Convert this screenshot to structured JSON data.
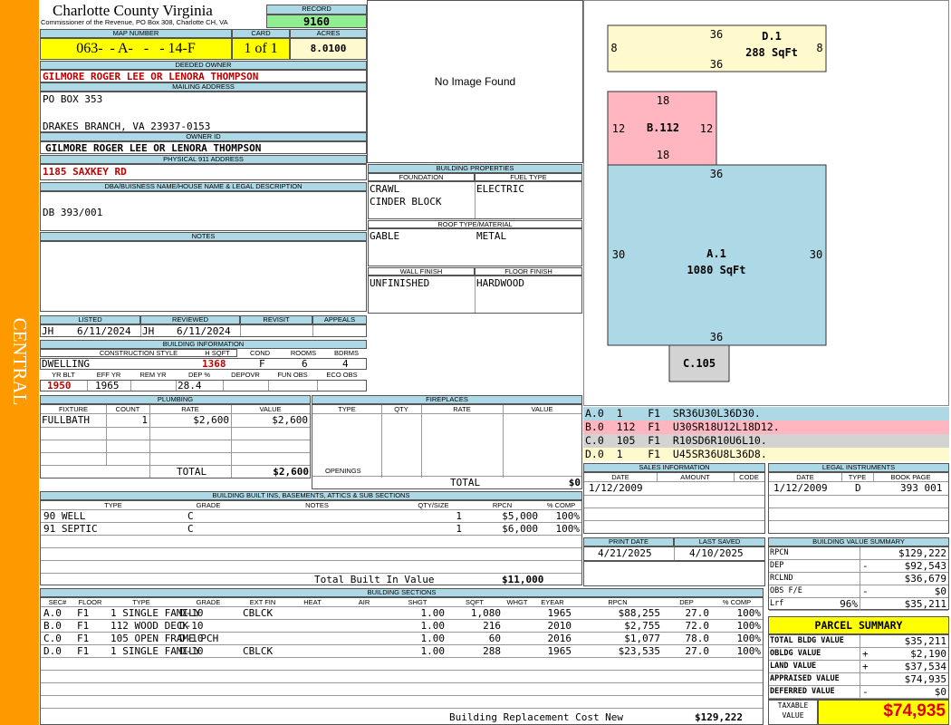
{
  "side_label": "CENTRAL",
  "header": {
    "county": "Charlotte County Virginia",
    "commissioner": "Commissioner of the Revenue, PO Box 308, Charlotte CH, VA",
    "record_label": "RECORD",
    "record": "9160",
    "map_number_label": "MAP NUMBER",
    "map_number": "063-  - A-   -   - 14-F",
    "card_label": "CARD",
    "card": "1 of 1",
    "acres_label": "ACRES",
    "acres": "8.0100"
  },
  "owner": {
    "deeded_label": "DEEDED OWNER",
    "deeded": "GILMORE ROGER LEE OR LENORA THOMPSON",
    "mailing_label": "MAILING ADDRESS",
    "mailing_line1": "PO BOX 353",
    "mailing_line2": "DRAKES BRANCH, VA 23937-0153",
    "owner_id_label": "OWNER ID",
    "owner_id": "GILMORE ROGER LEE OR LENORA THOMPSON",
    "physical_label": "PHYSICAL 911 ADDRESS",
    "physical": "1185 SAXKEY RD",
    "legal_label": "DBA/BUISNESS NAME/HOUSE NAME & LEGAL DESCRIPTION",
    "legal": "DB 393/001",
    "notes_label": "NOTES"
  },
  "photo": {
    "text": "No Image Found"
  },
  "building_properties": {
    "title": "BUILDING PROPERTIES",
    "foundation_label": "FOUNDATION",
    "fuel_label": "FUEL TYPE",
    "foundation1": "CRAWL",
    "foundation2": "CINDER BLOCK",
    "fuel": "ELECTRIC",
    "roof_label": "ROOF TYPE/MATERIAL",
    "roof_type": "GABLE",
    "roof_material": "METAL",
    "wall_label": "WALL FINISH",
    "floor_label": "FLOOR FINISH",
    "wall": "UNFINISHED",
    "floor": "HARDWOOD"
  },
  "listing": {
    "listed_label": "LISTED",
    "reviewed_label": "REVIEWED",
    "revisit_label": "REVISIT",
    "appeals_label": "APPEALS",
    "listed_by": "JH",
    "listed_date": "6/11/2024",
    "reviewed_by": "JH",
    "reviewed_date": "6/11/2024"
  },
  "building_info": {
    "title": "BUILDING INFORMATION",
    "style_label": "CONSTRUCTION STYLE",
    "hsqft_label": "H SQFT",
    "cond_label": "COND",
    "rooms_label": "ROOMS",
    "bdrms_label": "BDRMS",
    "style": "DWELLING",
    "hsqft": "1368",
    "cond": "F",
    "rooms": "6",
    "bdrms": "4",
    "yrblt_label": "YR BLT",
    "effyr_label": "EFF YR",
    "remyr_label": "REM YR",
    "dep_label": "DEP %",
    "depovr_label": "DEPOVR",
    "funobs_label": "FUN OBS",
    "ecoobs_label": "ECO OBS",
    "yrblt": "1950",
    "effyr": "1965",
    "dep": "28.4"
  },
  "plumbing": {
    "title": "PLUMBING",
    "cols": [
      "FIXTURE",
      "COUNT",
      "RATE",
      "VALUE"
    ],
    "rows": [
      {
        "fixture": "FULLBATH",
        "count": "1",
        "rate": "$2,600",
        "value": "$2,600"
      }
    ],
    "total_label": "TOTAL",
    "total": "$2,600"
  },
  "fireplaces": {
    "title": "FIREPLACES",
    "cols": [
      "TYPE",
      "QTY",
      "RATE",
      "VALUE"
    ],
    "openings_label": "OPENINGS",
    "total_label": "TOTAL",
    "total": "$0"
  },
  "builtins": {
    "title": "BUILDING BUILT INS, BASEMENTS, ATTICS & SUB SECTIONS",
    "cols": [
      "TYPE",
      "GRADE",
      "NOTES",
      "QTY/SIZE",
      "RPCN",
      "% COMP"
    ],
    "rows": [
      {
        "type": "90 WELL",
        "grade": "C",
        "notes": "",
        "qty": "1",
        "rpcn": "$5,000",
        "comp": "100%"
      },
      {
        "type": "91 SEPTIC",
        "grade": "C",
        "notes": "",
        "qty": "1",
        "rpcn": "$6,000",
        "comp": "100%"
      }
    ],
    "total_label": "Total Built In Value",
    "total": "$11,000"
  },
  "sections": {
    "title": "BUILDING SECTIONS",
    "cols": [
      "SEC#",
      "FLOOR",
      "TYPE",
      "GRADE",
      "EXT FIN",
      "HEAT",
      "AIR",
      "SHGT",
      "SQFT",
      "WHGT",
      "EYEAR",
      "RPCN",
      "DEP",
      "% COMP"
    ],
    "rows": [
      {
        "sec": "A.0",
        "floor": "F1",
        "type": "1 SINGLE FAMILY",
        "grade": "D-10",
        "ext": "CBLCK",
        "heat": "",
        "air": "",
        "shgt": "1.00",
        "sqft": "1,080",
        "whgt": "",
        "eyear": "1965",
        "rpcn": "$88,255",
        "dep": "27.0",
        "comp": "100%"
      },
      {
        "sec": "B.0",
        "floor": "F1",
        "type": "112 WOOD DECK",
        "grade": "D-10",
        "ext": "",
        "heat": "",
        "air": "",
        "shgt": "1.00",
        "sqft": "216",
        "whgt": "",
        "eyear": "2010",
        "rpcn": "$2,755",
        "dep": "72.0",
        "comp": "100%"
      },
      {
        "sec": "C.0",
        "floor": "F1",
        "type": "105 OPEN FRAME PCH",
        "grade": "D-10",
        "ext": "",
        "heat": "",
        "air": "",
        "shgt": "1.00",
        "sqft": "60",
        "whgt": "",
        "eyear": "2016",
        "rpcn": "$1,077",
        "dep": "78.0",
        "comp": "100%"
      },
      {
        "sec": "D.0",
        "floor": "F1",
        "type": "1 SINGLE FAMILY",
        "grade": "D-10",
        "ext": "CBLCK",
        "heat": "",
        "air": "",
        "shgt": "1.00",
        "sqft": "288",
        "whgt": "",
        "eyear": "1965",
        "rpcn": "$23,535",
        "dep": "27.0",
        "comp": "100%"
      }
    ],
    "total_label": "Building Replacement Cost New",
    "total": "$129,222"
  },
  "sketch": {
    "d": {
      "label": "D.1",
      "area": "288 SqFt",
      "top": "36",
      "bottom": "36",
      "left": "8",
      "right": "8"
    },
    "b": {
      "label": "B.112",
      "top": "18",
      "bottom": "18",
      "left": "12",
      "right": "12"
    },
    "a": {
      "label": "A.1",
      "area": "1080 SqFt",
      "top": "36",
      "bottom": "36",
      "left": "30",
      "right": "30"
    },
    "c": {
      "label": "C.105"
    },
    "colors": {
      "d": "#fffacd",
      "b": "#ffb6c1",
      "a": "#add8e6",
      "c": "#d3d3d3"
    }
  },
  "legend": [
    {
      "text": "A.0  1    F1  SR36U30L36D30.",
      "color": "#add8e6"
    },
    {
      "text": "B.0  112  F1  U30SR18U12L18D12.",
      "color": "#ffb6c1"
    },
    {
      "text": "C.0  105  F1  R10SD6R10U6L10.",
      "color": "#d3d3d3"
    },
    {
      "text": "D.0  1    F1  U45SR36U8L36D8.",
      "color": "#fffacd"
    }
  ],
  "sales": {
    "title": "SALES INFORMATION",
    "cols": [
      "DATE",
      "AMOUNT",
      "CODE"
    ],
    "rows": [
      {
        "date": "1/12/2009",
        "amount": "",
        "code": ""
      }
    ]
  },
  "legal_instruments": {
    "title": "LEGAL INSTRUMENTS",
    "cols": [
      "DATE",
      "TYPE",
      "BOOK PAGE"
    ],
    "rows": [
      {
        "date": "1/12/2009",
        "type": "D",
        "book": "393 001"
      }
    ]
  },
  "dates": {
    "print_label": "PRINT DATE",
    "saved_label": "LAST SAVED",
    "print": "4/21/2025",
    "saved": "4/10/2025"
  },
  "value_summary": {
    "title": "BUILDING VALUE SUMMARY",
    "rows": [
      {
        "label": "RPCN",
        "sign": "",
        "value": "$129,222"
      },
      {
        "label": "DEP",
        "sign": "-",
        "value": "$92,543"
      },
      {
        "label": "RCLND",
        "sign": "",
        "value": "$36,679"
      },
      {
        "label": "OBS F/E",
        "sign": "-",
        "value": "$0"
      },
      {
        "label": "Lrf",
        "pct": "96%",
        "sign": "",
        "value": "$35,211"
      }
    ]
  },
  "parcel": {
    "title": "PARCEL SUMMARY",
    "rows": [
      {
        "label": "TOTAL BLDG VALUE",
        "sign": "",
        "value": "$35,211"
      },
      {
        "label": "OBLDG VALUE",
        "sign": "+",
        "value": "$2,190"
      },
      {
        "label": "LAND VALUE",
        "sign": "+",
        "value": "$37,534"
      },
      {
        "label": "APPRAISED VALUE",
        "sign": "",
        "value": "$74,935"
      },
      {
        "label": "DEFERRED VALUE",
        "sign": "-",
        "value": "$0"
      }
    ],
    "taxable_label1": "TAXABLE",
    "taxable_label2": "VALUE",
    "taxable": "$74,935"
  }
}
